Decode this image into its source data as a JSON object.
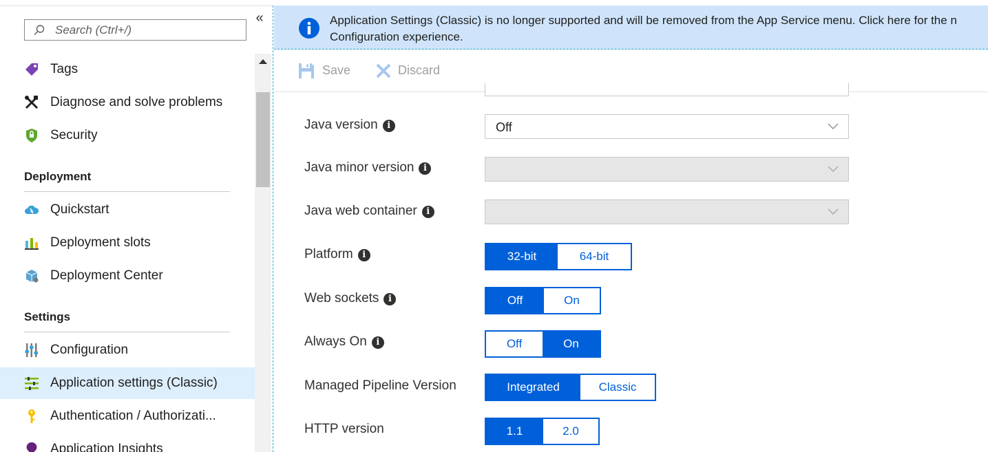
{
  "search": {
    "placeholder": "Search (Ctrl+/)"
  },
  "sidebar": {
    "items_top": [
      {
        "label": "Tags"
      },
      {
        "label": "Diagnose and solve problems"
      },
      {
        "label": "Security"
      }
    ],
    "sections": [
      {
        "title": "Deployment",
        "items": [
          {
            "label": "Quickstart"
          },
          {
            "label": "Deployment slots"
          },
          {
            "label": "Deployment Center"
          }
        ]
      },
      {
        "title": "Settings",
        "items": [
          {
            "label": "Configuration"
          },
          {
            "label": "Application settings (Classic)",
            "selected": true
          },
          {
            "label": "Authentication / Authorizati..."
          },
          {
            "label": "Application Insights"
          }
        ]
      }
    ]
  },
  "banner": {
    "line1": "Application Settings (Classic) is no longer supported and will be removed from the App Service menu. Click here for the n",
    "line2": "Configuration experience."
  },
  "toolbar": {
    "save_label": "Save",
    "discard_label": "Discard"
  },
  "fields": {
    "java_version": {
      "label": "Java version",
      "value": "Off"
    },
    "java_minor_version": {
      "label": "Java minor version",
      "value": ""
    },
    "java_web_container": {
      "label": "Java web container",
      "value": ""
    },
    "platform": {
      "label": "Platform",
      "options": [
        "32-bit",
        "64-bit"
      ],
      "selected": "32-bit"
    },
    "web_sockets": {
      "label": "Web sockets",
      "options": [
        "Off",
        "On"
      ],
      "selected": "Off"
    },
    "always_on": {
      "label": "Always On",
      "options": [
        "Off",
        "On"
      ],
      "selected": "On"
    },
    "managed_pipeline": {
      "label": "Managed Pipeline Version",
      "options": [
        "Integrated",
        "Classic"
      ],
      "selected": "Integrated"
    },
    "http_version": {
      "label": "HTTP version",
      "options": [
        "1.1",
        "2.0"
      ],
      "selected": "1.1"
    }
  },
  "colors": {
    "accent": "#0060d9",
    "banner_bg": "#cfe4fa",
    "selected_nav_bg": "#ddeefd"
  }
}
